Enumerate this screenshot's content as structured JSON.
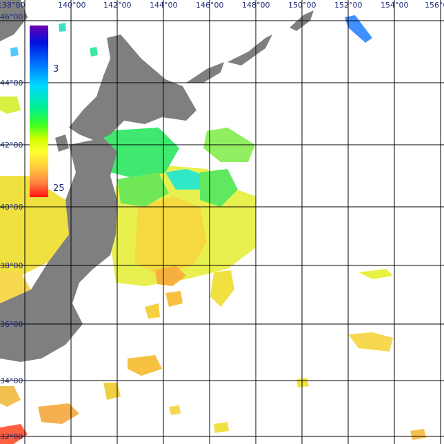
{
  "map": {
    "lon_labels": [
      "138°00",
      "140°00",
      "142°00",
      "144°00",
      "146°00",
      "148°00",
      "150°00",
      "152°00",
      "154°00",
      "156°0"
    ],
    "lat_labels": [
      "46°00",
      "44°00",
      "42°00",
      "40°00",
      "38°00",
      "36°00",
      "34°00",
      "32°00"
    ],
    "land_color": "#7f7f7f",
    "grid_color": "#000000",
    "background_color": "#ffffff"
  },
  "color_scale": {
    "labels": [
      "3",
      "25"
    ],
    "gradient": [
      "#6a00b0",
      "#0010e0",
      "#0070ff",
      "#00d8ff",
      "#00f090",
      "#40ff20",
      "#d0ff00",
      "#ffff30",
      "#ffc040",
      "#ff8040",
      "#ff1010"
    ]
  }
}
